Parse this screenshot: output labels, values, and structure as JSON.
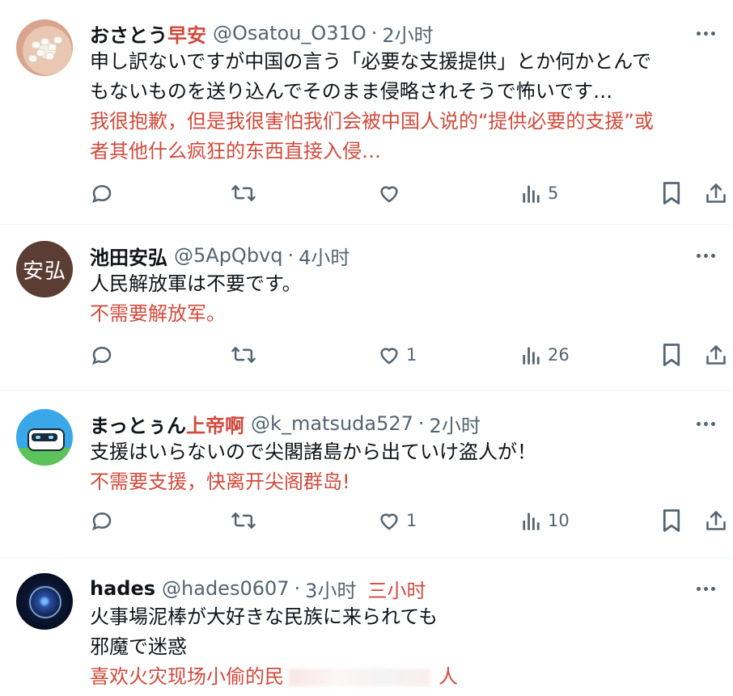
{
  "posts": [
    {
      "name": "おさとう",
      "name_translation": "早安",
      "handle": "@Osatou_O31O",
      "separator": "·",
      "time": "2小时",
      "text_lines": [
        "申し訳ないですが中国の言う「必要な支援提供」とか何かとんで",
        "もないものを送り込んでそのまま侵略されそうで怖いです…"
      ],
      "translation_lines": [
        "我很抱歉，但是我很害怕我们会被中国人说的“提供必要的支援”或",
        "者其他什么疯狂的东西直接入侵…"
      ],
      "views": "5",
      "likes": ""
    },
    {
      "name": "池田安弘",
      "avatar_text": "安弘",
      "handle": "@5ApQbvq",
      "separator": "·",
      "time": "4小时",
      "text_lines": [
        "人民解放軍は不要です。"
      ],
      "translation_lines": [
        "不需要解放军。"
      ],
      "likes": "1",
      "views": "26"
    },
    {
      "name": "まっとぅん",
      "name_translation": "上帝啊",
      "handle": "@k_matsuda527",
      "separator": "·",
      "time": "2小时",
      "text_lines": [
        "支援はいらないので尖閣諸島から出ていけ盗人が！"
      ],
      "translation_lines": [
        "不需要支援，快离开尖阁群岛!"
      ],
      "likes": "1",
      "views": "10"
    },
    {
      "name": "hades",
      "handle": "@hades0607",
      "separator": "·",
      "time": "3小时",
      "time_translation": "三小时",
      "text_lines": [
        "火事場泥棒が大好きな民族に来られても",
        "邪魔で迷惑"
      ],
      "translation_start": "喜欢火灾现场小偷的民",
      "translation_end": "人"
    }
  ],
  "icons": {
    "reply": "reply-icon",
    "retweet": "retweet-icon",
    "like": "like-icon",
    "views": "views-icon",
    "bookmark": "bookmark-icon",
    "share": "share-icon",
    "more": "more-icon"
  },
  "colors": {
    "text": "#0f1419",
    "muted": "#536471",
    "translation": "#d24a3c",
    "divider": "#eff3f4"
  }
}
